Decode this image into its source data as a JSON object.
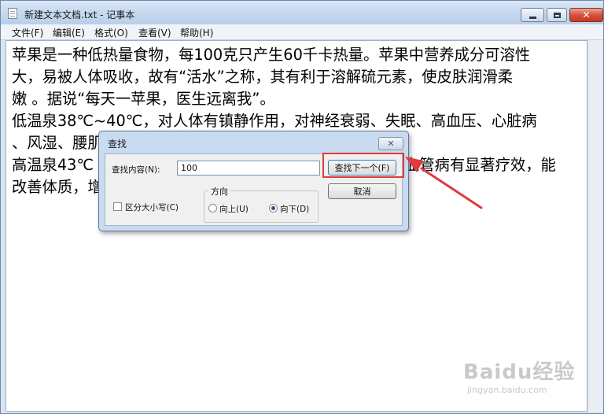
{
  "window": {
    "title": "新建文本文档.txt - 记事本",
    "controls": {
      "minimize": "",
      "maximize": "",
      "close": "✕"
    }
  },
  "menu": {
    "items": [
      {
        "label": "文件(F)"
      },
      {
        "label": "编辑(E)"
      },
      {
        "label": "格式(O)"
      },
      {
        "label": "查看(V)"
      },
      {
        "label": "帮助(H)"
      }
    ]
  },
  "document": {
    "lines": [
      "苹果是一种低热量食物，每100克只产生60千卡热量。苹果中营养成分可溶性",
      "大，易被人体吸收，故有“活水”之称，其有利于溶解硫元素，使皮肤润滑柔",
      "嫩 。据说“每天一苹果，医生远离我”。",
      "低温泉38℃~40℃，对人体有镇静作用，对神经衰弱、失眠、高血压、心脏病",
      "、风湿、腰肌",
      "高温泉43℃",
      "改善体质，增",
      "血管病有显著疗效，能"
    ]
  },
  "find_dialog": {
    "title": "查找",
    "close": "✕",
    "find_label": "查找内容(N):",
    "find_value": "100",
    "find_next_label": "查找下一个(F)",
    "cancel_label": "取消",
    "direction_label": "方向",
    "up_label": "向上(U)",
    "down_label": "向下(D)",
    "direction_selected": "down",
    "match_case_label": "区分大小写(C)",
    "match_case_checked": false
  },
  "annotation": {
    "color": "#e03a3a"
  },
  "watermark": {
    "brand": "Baidu经验",
    "url": "jingyan.baidu.com"
  }
}
